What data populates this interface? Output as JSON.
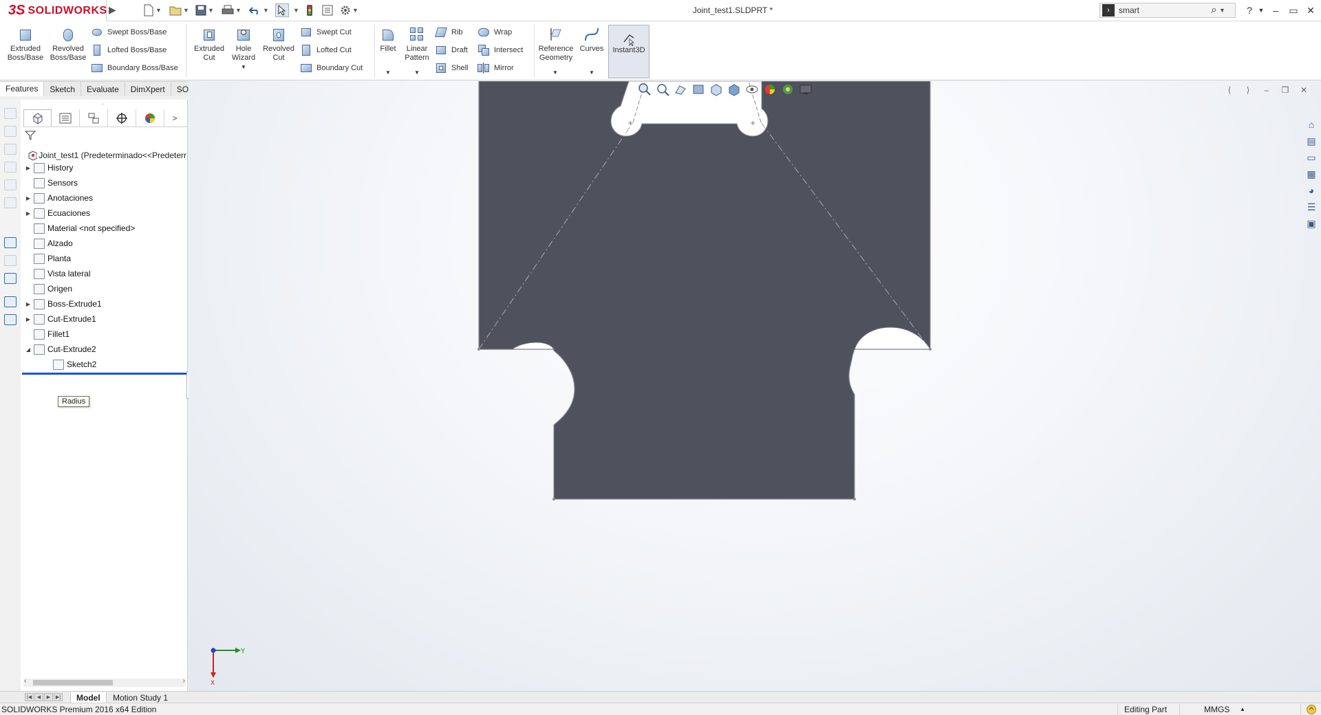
{
  "app": {
    "brand": "SOLIDWORKS",
    "logo_prefix": "3S",
    "document_title": "Joint_test1.SLDPRT *"
  },
  "search": {
    "value": "smart"
  },
  "window_controls": [
    "?",
    "–",
    "▭",
    "✕"
  ],
  "ribbon": {
    "extruded_boss": "Extruded Boss/Base",
    "revolved_boss": "Revolved Boss/Base",
    "swept_boss": "Swept Boss/Base",
    "lofted_boss": "Lofted Boss/Base",
    "boundary_boss": "Boundary Boss/Base",
    "extruded_cut": "Extruded Cut",
    "hole_wizard": "Hole Wizard",
    "revolved_cut": "Revolved Cut",
    "swept_cut": "Swept Cut",
    "lofted_cut": "Lofted Cut",
    "boundary_cut": "Boundary Cut",
    "fillet": "Fillet",
    "linear_pattern": "Linear Pattern",
    "rib": "Rib",
    "draft": "Draft",
    "shell": "Shell",
    "wrap": "Wrap",
    "intersect": "Intersect",
    "mirror": "Mirror",
    "reference_geometry": "Reference Geometry",
    "curves": "Curves",
    "instant3d": "Instant3D"
  },
  "command_tabs": [
    "Features",
    "Sketch",
    "Evaluate",
    "DimXpert",
    "SOLIDWORKS Add-Ins"
  ],
  "feature_tree": {
    "root": "Joint_test1  (Predeterminado<<Predeterr",
    "items": [
      {
        "label": "History",
        "expand": "right",
        "icon": "history-icon"
      },
      {
        "label": "Sensors",
        "expand": "",
        "icon": "sensors-icon"
      },
      {
        "label": "Anotaciones",
        "expand": "right",
        "icon": "annotations-icon"
      },
      {
        "label": "Ecuaciones",
        "expand": "right",
        "icon": "equations-icon"
      },
      {
        "label": "Material <not specified>",
        "expand": "",
        "icon": "material-icon"
      },
      {
        "label": "Alzado",
        "expand": "",
        "icon": "plane-icon"
      },
      {
        "label": "Planta",
        "expand": "",
        "icon": "plane-icon"
      },
      {
        "label": "Vista lateral",
        "expand": "",
        "icon": "plane-icon"
      },
      {
        "label": "Origen",
        "expand": "",
        "icon": "origin-icon"
      },
      {
        "label": "Boss-Extrude1",
        "expand": "right",
        "icon": "boss-extrude-icon"
      },
      {
        "label": "Cut-Extrude1",
        "expand": "right",
        "icon": "cut-extrude-icon"
      },
      {
        "label": "Fillet1",
        "expand": "",
        "icon": "fillet-icon"
      },
      {
        "label": "Cut-Extrude2",
        "expand": "down",
        "icon": "cut-extrude-icon"
      },
      {
        "label": "Sketch2",
        "expand": "",
        "icon": "sketch-icon",
        "indent": true
      }
    ]
  },
  "tooltip": "Radius",
  "triad": {
    "y_label": "Y",
    "x_label": "X"
  },
  "bottom_tabs": [
    "Model",
    "Motion Study 1"
  ],
  "status": {
    "edition": "SOLIDWORKS Premium 2016 x64 Edition",
    "mode": "Editing Part",
    "units": "MMGS"
  },
  "colors": {
    "part_face": "#4f525c",
    "brand_red": "#c8102e",
    "rollback_bar": "#1e56c5"
  }
}
